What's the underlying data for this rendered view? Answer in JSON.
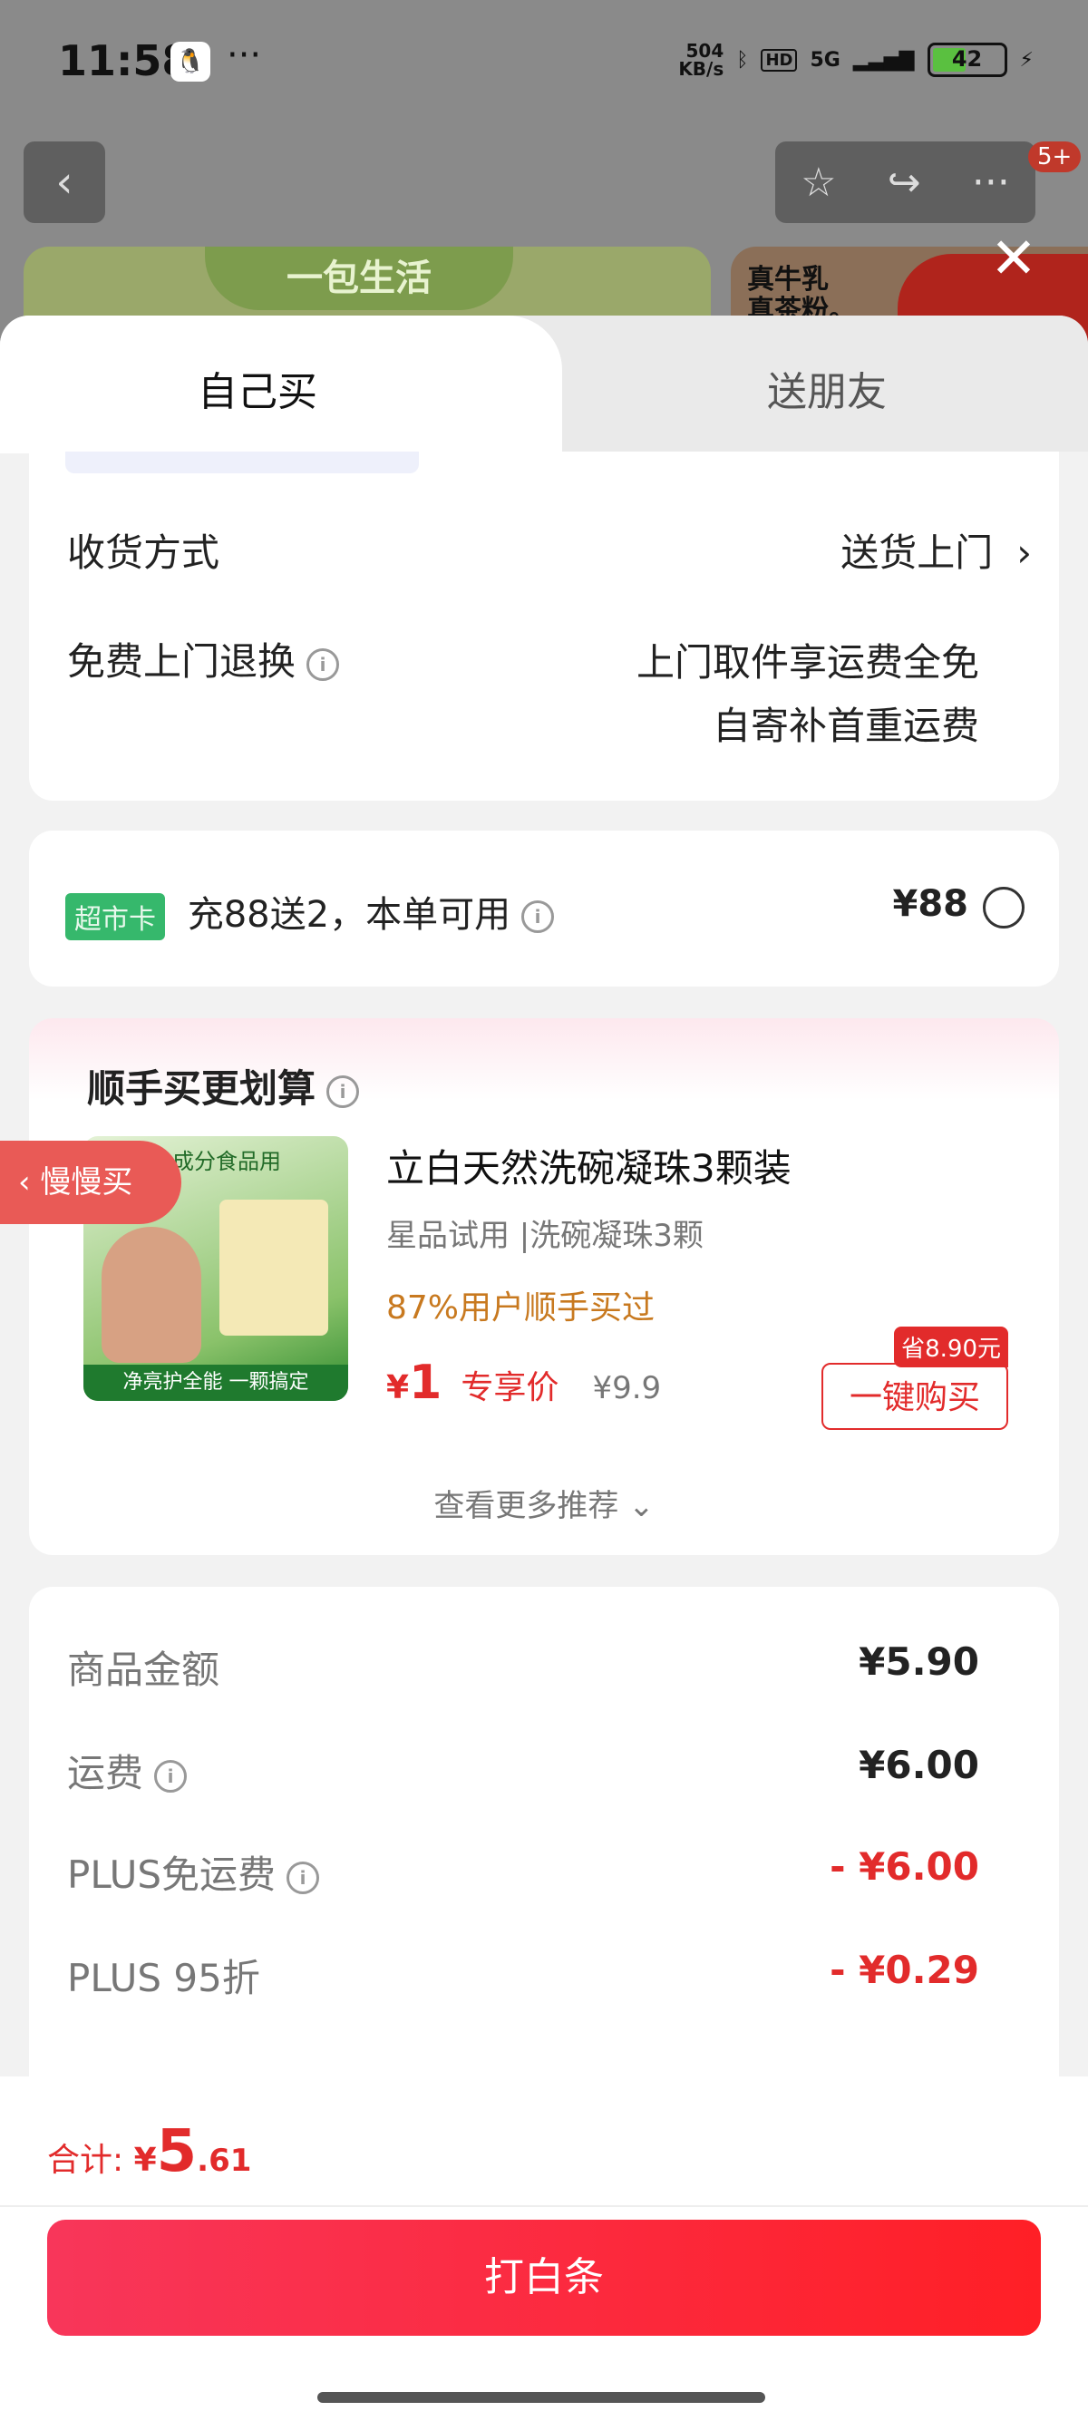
{
  "status_bar": {
    "time": "11:58",
    "speed_value": "504",
    "speed_unit": "KB/s",
    "network": "5G",
    "battery": "42"
  },
  "background_page": {
    "badge": "5+",
    "card1_text": "一包生活",
    "card2_text": "真牛乳\n真茶粉。"
  },
  "tabs": {
    "self_buy": "自己买",
    "gift": "送朋友"
  },
  "delivery": {
    "method_label": "收货方式",
    "method_value": "送货上门",
    "return_label": "免费上门退换",
    "return_value_line1": "上门取件享运费全免",
    "return_value_line2": "自寄补首重运费"
  },
  "floating": {
    "manman": "慢慢买"
  },
  "supermarket_card": {
    "badge": "超市卡",
    "text": "充88送2，本单可用",
    "price": "¥88"
  },
  "addon": {
    "title": "顺手买更划算",
    "product": {
      "image_top_text": "全成分食品用",
      "image_band_text": "净亮护全能 一颗搞定",
      "name": "立白天然洗碗凝珠3颗装",
      "subtitle": "星品试用 |洗碗凝珠3颗",
      "popularity": "87%用户顺手买过",
      "price_symbol": "¥",
      "price": "1",
      "price_label": "专享价",
      "original_price": "¥9.9",
      "save_tag": "省8.90元",
      "buy_button": "一键购买"
    },
    "more": "查看更多推荐"
  },
  "summary": {
    "rows": [
      {
        "label": "商品金额",
        "value": "¥5.90"
      },
      {
        "label": "运费",
        "value": "¥6.00"
      },
      {
        "label": "PLUS免运费",
        "value": "- ¥6.00"
      },
      {
        "label": "PLUS 95折",
        "value": "- ¥0.29"
      }
    ]
  },
  "footer": {
    "total_label": "合计: ",
    "total_symbol": "¥",
    "total_int": "5",
    "total_dec": ".61",
    "pay_button": "打白条"
  },
  "colors": {
    "accent_red": "#e22b2b",
    "green_badge": "#36b86c",
    "orange_text": "#c8791f"
  }
}
